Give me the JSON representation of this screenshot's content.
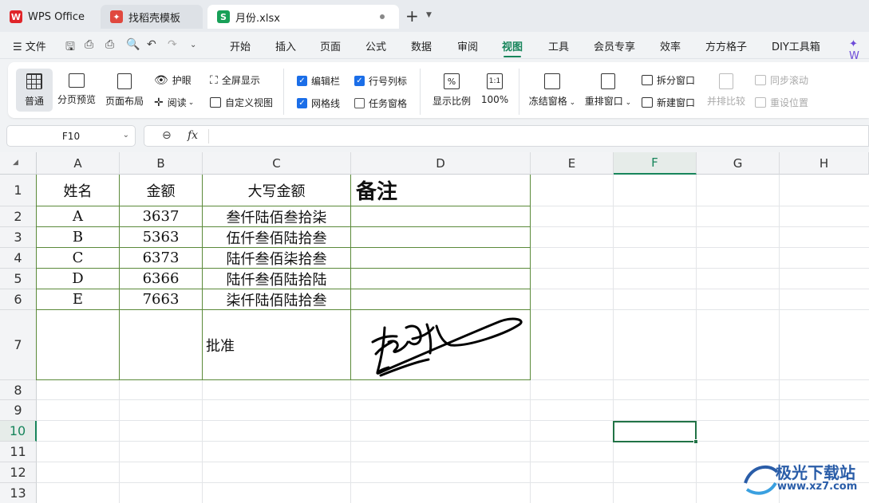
{
  "tabs": [
    {
      "label": "WPS Office",
      "icon": "wps-logo-icon"
    },
    {
      "label": "找稻壳模板",
      "icon": "docer-icon"
    },
    {
      "label": "月份.xlsx",
      "icon": "spreadsheet-icon"
    }
  ],
  "menu": {
    "file": "文件",
    "items": [
      "开始",
      "插入",
      "页面",
      "公式",
      "数据",
      "审阅",
      "视图",
      "工具",
      "会员专享",
      "效率",
      "方方格子",
      "DIY工具箱"
    ],
    "active": "视图",
    "overflow": "W"
  },
  "ribbon": {
    "normal": "普通",
    "page_break": "分页预览",
    "page_layout": "页面布局",
    "eye_protect": "护眼",
    "reading": "阅读",
    "fullscreen": "全屏显示",
    "custom_view": "自定义视图",
    "formula_bar": "编辑栏",
    "gridlines": "网格线",
    "headings": "行号列标",
    "task_pane": "任务窗格",
    "zoom": "显示比例",
    "zoom100": "100%",
    "freeze": "冻结窗格",
    "arrange": "重排窗口",
    "split": "拆分窗口",
    "new_window": "新建窗口",
    "side_by_side": "并排比较",
    "sync_scroll": "同步滚动",
    "reset_pos": "重设位置",
    "checks": {
      "formula_bar": true,
      "gridlines": true,
      "headings": true,
      "task_pane": false
    }
  },
  "formula": {
    "cell_ref": "F10",
    "fx": "fx",
    "value": ""
  },
  "columns": [
    "A",
    "B",
    "C",
    "D",
    "E",
    "F",
    "G",
    "H"
  ],
  "rows": [
    "1",
    "2",
    "3",
    "4",
    "5",
    "6",
    "7",
    "8",
    "9",
    "10",
    "11",
    "12",
    "13"
  ],
  "active_cell": {
    "col": "F",
    "row": "10"
  },
  "table": {
    "headers": [
      "姓名",
      "金额",
      "大写金额",
      "备注"
    ],
    "rows": [
      [
        "A",
        "3637",
        "叁仟陆佰叁拾柒",
        ""
      ],
      [
        "B",
        "5363",
        "伍仟叁佰陆拾叁",
        ""
      ],
      [
        "C",
        "6373",
        "陆仟叁佰柒拾叁",
        ""
      ],
      [
        "D",
        "6366",
        "陆仟叁佰陆拾陆",
        ""
      ],
      [
        "E",
        "7663",
        "柒仟陆佰陆拾叁",
        ""
      ]
    ],
    "approve_label": "批准"
  },
  "watermark": {
    "text": "极光下载站",
    "url": "www.xz7.com"
  },
  "colors": {
    "accent": "#17855b",
    "selection": "#217346",
    "table_border": "#5b8a3a",
    "checkbox": "#1b6ee8"
  }
}
